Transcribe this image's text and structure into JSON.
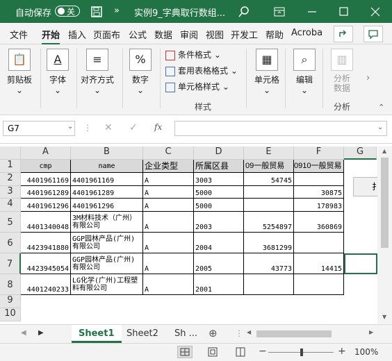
{
  "titlebar": {
    "autosave": "自动保存",
    "toggle": "关",
    "chevrons": "»",
    "doc_title": "实例9_字典取行数组..."
  },
  "menu": [
    "文件",
    "开始",
    "插入",
    "页面布",
    "公式",
    "数据",
    "审阅",
    "视图",
    "开发工",
    "帮助",
    "Acroba"
  ],
  "ribbon": {
    "paste": "剪贴板",
    "font": "字体",
    "align": "对齐方式",
    "number": "数字",
    "cond_format": "条件格式",
    "table_format": "套用表格格式",
    "cell_style": "单元格样式",
    "cells": "单元格",
    "edit": "编辑",
    "analyze": "分析数据",
    "group_style": "样式",
    "group_analyze": "分析"
  },
  "namebox": "G7",
  "columns": [
    "A",
    "B",
    "C",
    "D",
    "E",
    "F",
    "G"
  ],
  "rows": [
    "1",
    "2",
    "3",
    "4",
    "5",
    "6",
    "7",
    "8",
    "9",
    "10"
  ],
  "header": [
    "cmp",
    "name",
    "企业类型",
    "所属区县",
    "09一般贸易",
    "0910一般贸易"
  ],
  "data": [
    [
      "4401961169",
      "4401961169",
      "A",
      "3003",
      "54745",
      ""
    ],
    [
      "4401961289",
      "4401961289",
      "A",
      "5000",
      "",
      "30875"
    ],
    [
      "4401961296",
      "4401961296",
      "A",
      "5000",
      "",
      "178983"
    ],
    [
      "4401340048",
      "3M材料技术（广州）有限公司",
      "A",
      "2003",
      "5254897",
      "360869"
    ],
    [
      "4423941880",
      "GGP园林产品(广州)有限公司",
      "A",
      "2004",
      "3681299",
      ""
    ],
    [
      "4423945054",
      "GGP园林产品(广州)有限公司",
      "A",
      "2005",
      "43773",
      "14415"
    ],
    [
      "4401240233",
      "LG化学(广州)工程塑料有限公司",
      "A",
      "2001",
      "",
      ""
    ]
  ],
  "sheets": [
    "Sheet1",
    "Sheet2",
    "Sh ..."
  ],
  "zoom": "100%",
  "colors": {
    "brand": "#217346"
  }
}
